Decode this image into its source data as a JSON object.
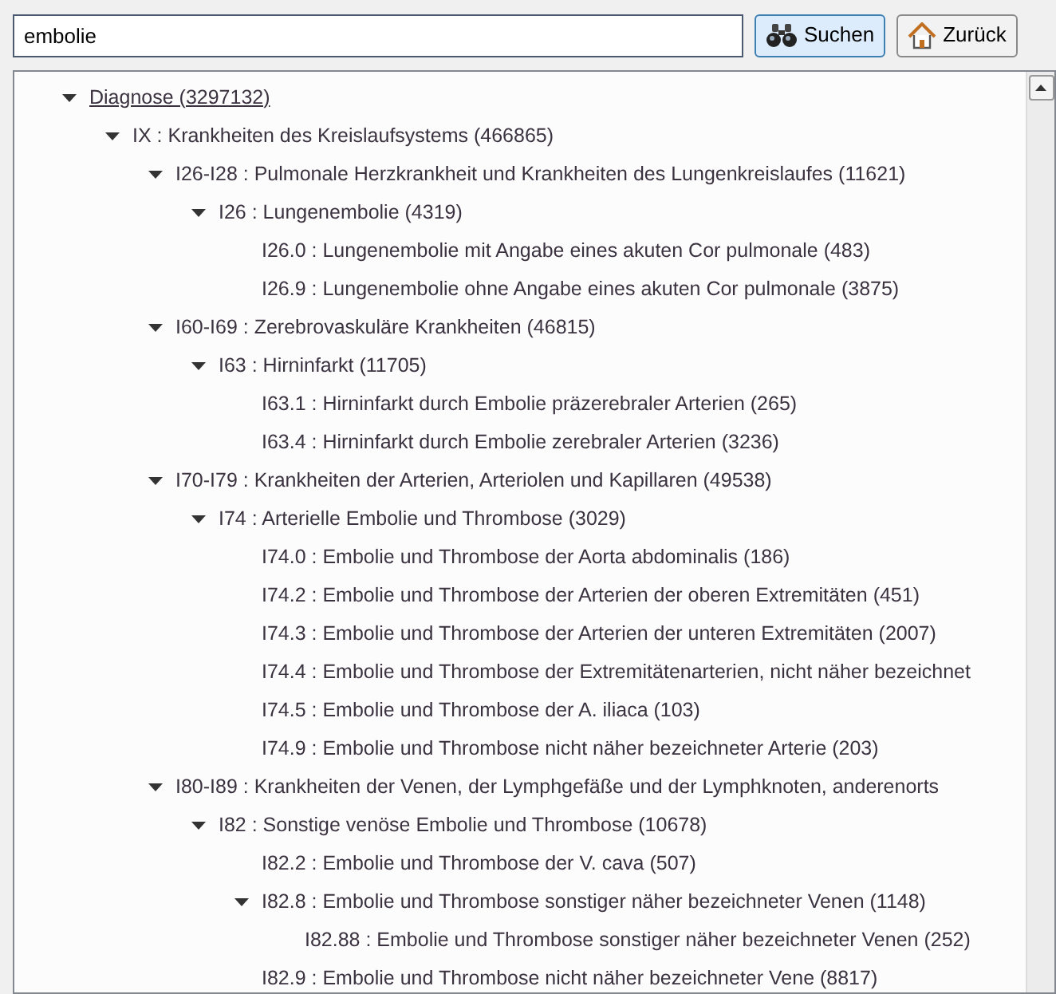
{
  "search": {
    "value": "embolie"
  },
  "buttons": [
    {
      "kind": "search",
      "label": "Suchen",
      "selected": true
    },
    {
      "kind": "home",
      "label": "Zurück",
      "selected": false
    }
  ],
  "tree": [
    {
      "label": "Diagnose (3297132)",
      "link": true,
      "expanded": true,
      "children": [
        {
          "label": "IX : Krankheiten des Kreislaufsystems (466865)",
          "expanded": true,
          "children": [
            {
              "label": "I26-I28 : Pulmonale Herzkrankheit und Krankheiten des Lungenkreislaufes (11621)",
              "expanded": true,
              "children": [
                {
                  "label": "I26 : Lungenembolie (4319)",
                  "expanded": true,
                  "children": [
                    {
                      "label": "I26.0 : Lungenembolie mit Angabe eines akuten Cor pulmonale (483)"
                    },
                    {
                      "label": "I26.9 : Lungenembolie ohne Angabe eines akuten Cor pulmonale (3875)"
                    }
                  ]
                }
              ]
            },
            {
              "label": "I60-I69 : Zerebrovaskuläre Krankheiten (46815)",
              "expanded": true,
              "children": [
                {
                  "label": "I63 : Hirninfarkt (11705)",
                  "expanded": true,
                  "children": [
                    {
                      "label": "I63.1 : Hirninfarkt durch Embolie präzerebraler Arterien (265)"
                    },
                    {
                      "label": "I63.4 : Hirninfarkt durch Embolie zerebraler Arterien (3236)"
                    }
                  ]
                }
              ]
            },
            {
              "label": "I70-I79 : Krankheiten der Arterien, Arteriolen und Kapillaren (49538)",
              "expanded": true,
              "children": [
                {
                  "label": "I74 : Arterielle Embolie und Thrombose (3029)",
                  "expanded": true,
                  "children": [
                    {
                      "label": "I74.0 : Embolie und Thrombose der Aorta abdominalis (186)"
                    },
                    {
                      "label": "I74.2 : Embolie und Thrombose der Arterien der oberen Extremitäten (451)"
                    },
                    {
                      "label": "I74.3 : Embolie und Thrombose der Arterien der unteren Extremitäten (2007)"
                    },
                    {
                      "label": "I74.4 : Embolie und Thrombose der Extremitätenarterien, nicht näher bezeichnet"
                    },
                    {
                      "label": "I74.5 : Embolie und Thrombose der A. iliaca (103)"
                    },
                    {
                      "label": "I74.9 : Embolie und Thrombose nicht näher bezeichneter Arterie (203)"
                    }
                  ]
                }
              ]
            },
            {
              "label": "I80-I89 : Krankheiten der Venen, der Lymphgefäße und der Lymphknoten, anderenorts",
              "expanded": true,
              "children": [
                {
                  "label": "I82 : Sonstige venöse Embolie und Thrombose (10678)",
                  "expanded": true,
                  "children": [
                    {
                      "label": "I82.2 : Embolie und Thrombose der V. cava (507)"
                    },
                    {
                      "label": "I82.8 : Embolie und Thrombose sonstiger näher bezeichneter Venen (1148)",
                      "expanded": true,
                      "children": [
                        {
                          "label": "I82.88 : Embolie und Thrombose sonstiger näher bezeichneter Venen (252)"
                        }
                      ]
                    },
                    {
                      "label": "I82.9 : Embolie und Thrombose nicht näher bezeichneter Vene (8817)"
                    }
                  ]
                }
              ]
            }
          ]
        }
      ]
    }
  ]
}
